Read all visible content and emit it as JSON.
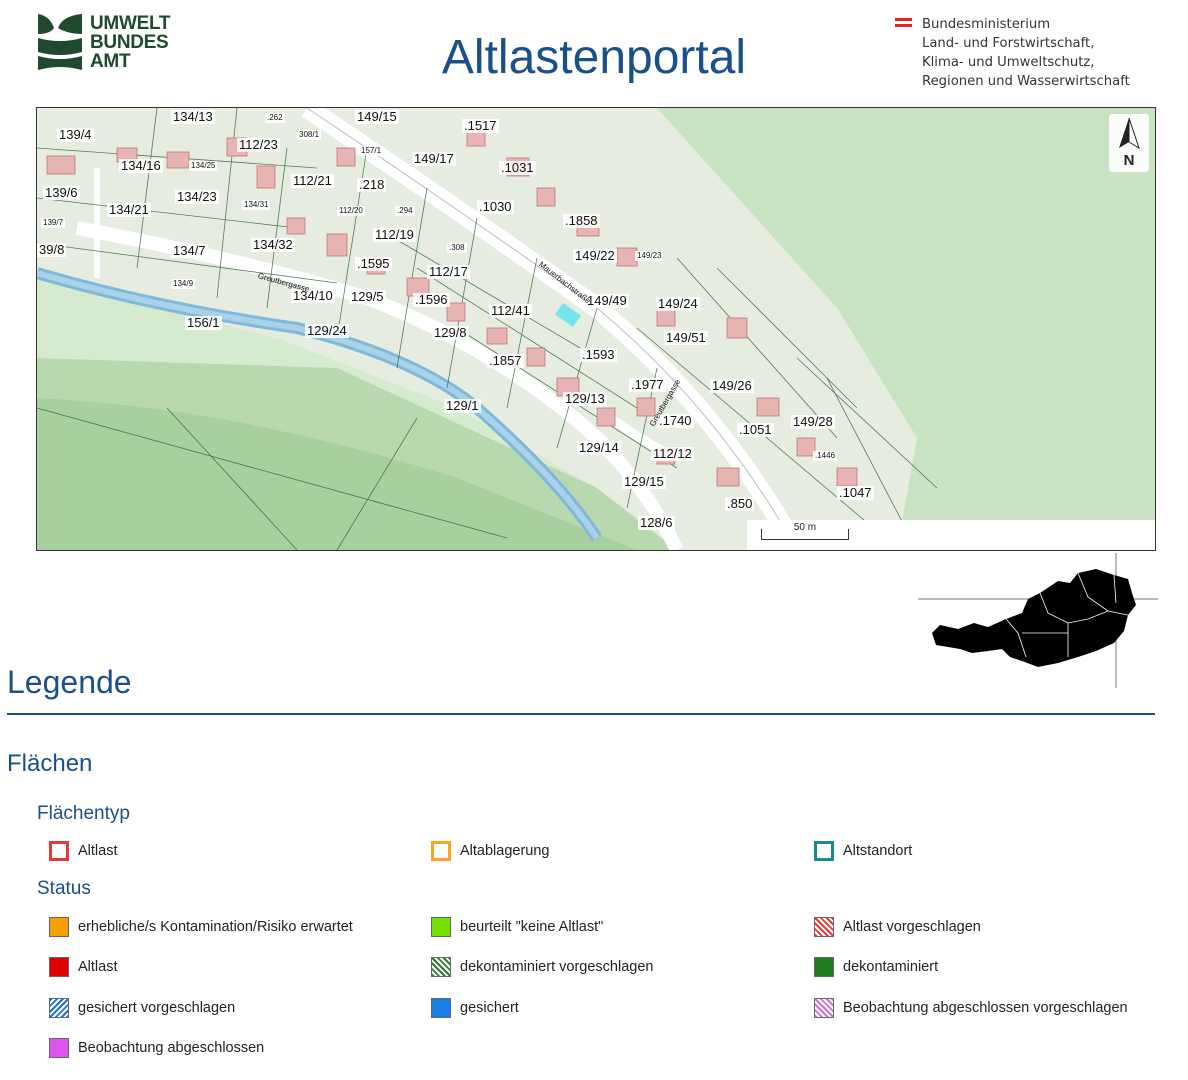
{
  "header": {
    "logo_lines": [
      "UMWELT",
      "BUNDES",
      "AMT"
    ],
    "title": "Altlastenportal",
    "ministry_lines": [
      "Bundesministerium",
      "Land- und Forstwirtschaft,",
      "Klima- und Umweltschutz,",
      "Regionen und Wasserwirtschaft"
    ]
  },
  "map": {
    "north_label": "N",
    "scale_label": "50 m",
    "parcels": [
      "134/13",
      ".262",
      "149/15",
      ".1517",
      "139/4",
      "308/1",
      "112/23",
      "157/1",
      "149/17",
      "134/16",
      "134/25",
      ".1031",
      "112/21",
      ".218",
      "139/6",
      "134/23",
      "134/31",
      "112/20",
      ".294",
      ".1030",
      "134/21",
      "139/7",
      ".1858",
      "112/19",
      "39/8",
      "134/7",
      "134/32",
      ".308",
      "149/22",
      "149/23",
      ".1595",
      "112/17",
      "134/9",
      "134/10",
      "129/5",
      ".1596",
      "149/49",
      "149/24",
      "156/1",
      "112/41",
      "129/24",
      "129/8",
      "149/51",
      ".1593",
      ".1857",
      ".1977",
      "149/26",
      "129/13",
      "129/1",
      ".1740",
      ".1051",
      "149/28",
      "129/14",
      "112/12",
      ".1446",
      "129/15",
      ".1047",
      ".850",
      "128/6"
    ],
    "streets": [
      "Mauerbachstraße",
      "Greutbergasse",
      "Greutbergasse"
    ]
  },
  "legend": {
    "title": "Legende",
    "section_title": "Flächen",
    "types_title": "Flächentyp",
    "types": [
      {
        "label": "Altlast",
        "color": "#e53935"
      },
      {
        "label": "Altablagerung",
        "color": "#f5a623"
      },
      {
        "label": "Altstandort",
        "color": "#1a8a8a"
      }
    ],
    "status_title": "Status",
    "status": [
      {
        "label": "erhebliche/s Kontamination/Risiko erwartet",
        "color": "#f5a000",
        "style": "solid"
      },
      {
        "label": "beurteilt \"keine Altlast\"",
        "color": "#76e000",
        "style": "solid"
      },
      {
        "label": "Altlast vorgeschlagen",
        "color": "#e53935",
        "style": "hatch"
      },
      {
        "label": "Altlast",
        "color": "#e00000",
        "style": "solid"
      },
      {
        "label": "dekontaminiert vorgeschlagen",
        "color": "#2e7d32",
        "style": "hatch"
      },
      {
        "label": "dekontaminiert",
        "color": "#1e7b1e",
        "style": "solid"
      },
      {
        "label": "gesichert vorgeschlagen",
        "color": "#1976d2",
        "style": "hatch"
      },
      {
        "label": "gesichert",
        "color": "#1a7ee6",
        "style": "solid"
      },
      {
        "label": "Beobachtung abgeschlossen vorgeschlagen",
        "color": "#d070e0",
        "style": "hatch"
      },
      {
        "label": "Beobachtung abgeschlossen",
        "color": "#dd55ee",
        "style": "solid"
      }
    ]
  }
}
